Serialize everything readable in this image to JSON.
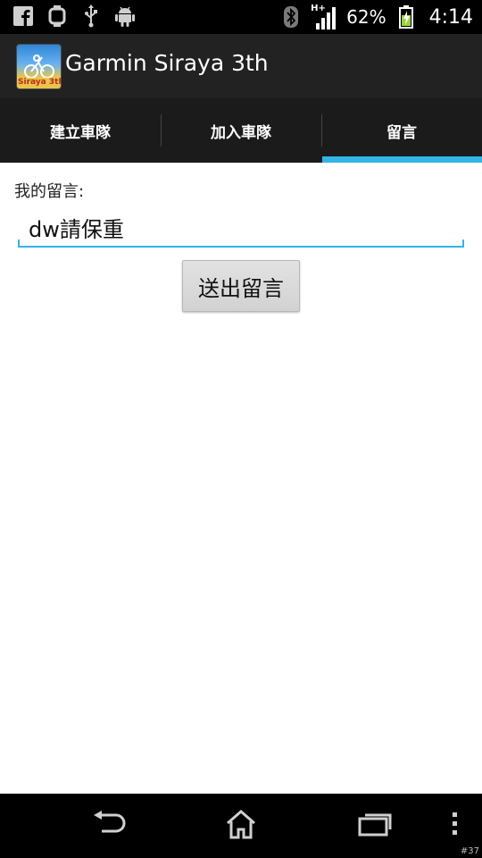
{
  "status_bar": {
    "icons_left": [
      "facebook-icon",
      "watch-icon",
      "usb-icon",
      "android-icon"
    ],
    "icons_right": [
      "bluetooth-icon",
      "signal-icon",
      "battery-icon"
    ],
    "network": "H+",
    "battery": "62%",
    "time": "4:14"
  },
  "app": {
    "title": "Garmin Siraya 3th",
    "logo_text": "Siraya 3th"
  },
  "tabs": [
    {
      "label": "建立車隊",
      "selected": false
    },
    {
      "label": "加入車隊",
      "selected": false
    },
    {
      "label": "留言",
      "selected": true
    }
  ],
  "form": {
    "label": "我的留言:",
    "input_value": "dw請保重",
    "submit_label": "送出留言"
  },
  "nav": {
    "icons": [
      "back-icon",
      "home-icon",
      "recent-apps-icon",
      "menu-icon"
    ]
  },
  "watermark": "#37",
  "colors": {
    "accent": "#33b5e5",
    "action_bar": "#222222",
    "tab_bar": "#1b1b1b"
  }
}
